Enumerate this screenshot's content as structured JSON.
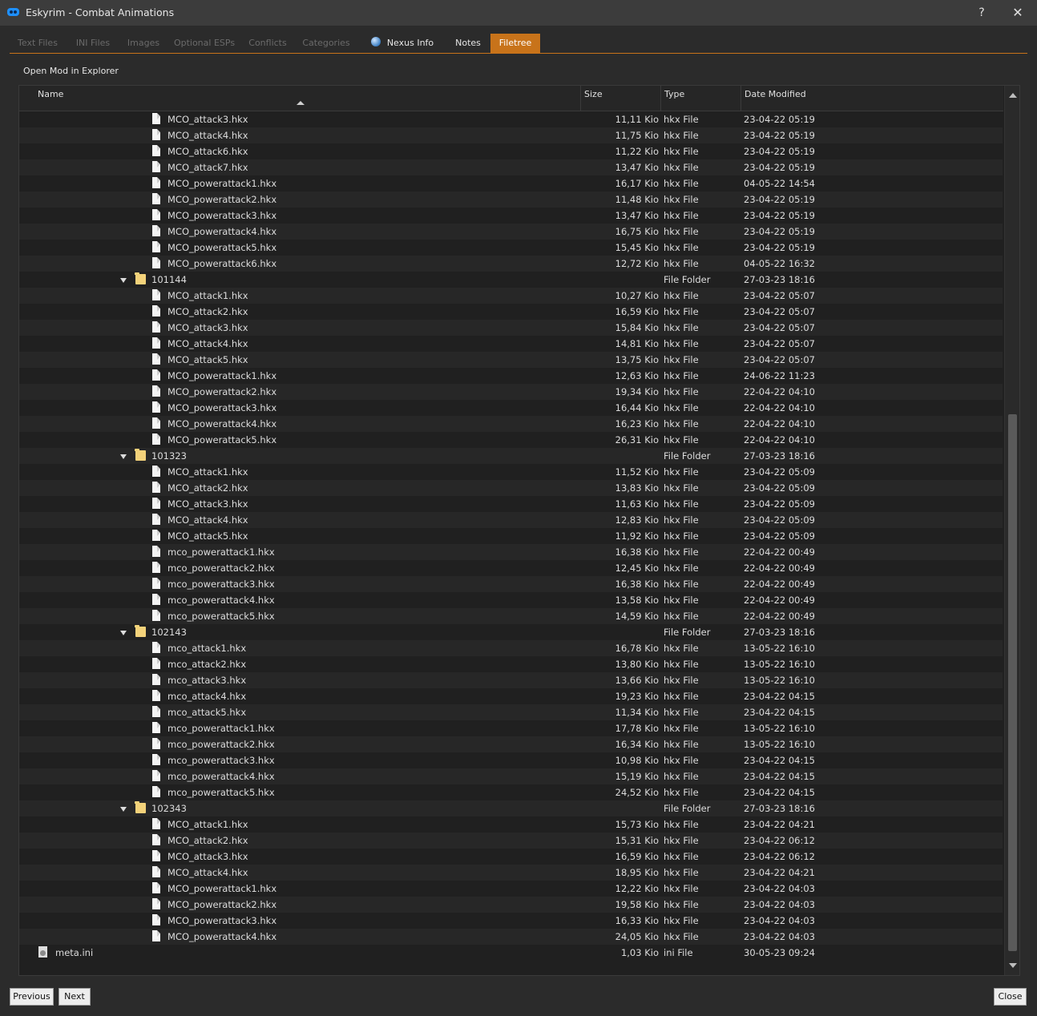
{
  "window": {
    "title": "Eskyrim - Combat Animations",
    "help": "?",
    "close": "✕"
  },
  "tabs": [
    {
      "label": "Text Files"
    },
    {
      "label": "INI Files"
    },
    {
      "label": "Images"
    },
    {
      "label": "Optional ESPs"
    },
    {
      "label": "Conflicts"
    },
    {
      "label": "Categories"
    },
    {
      "label": "Nexus Info",
      "icon": "globe-icon"
    },
    {
      "label": "Notes"
    },
    {
      "label": "Filetree"
    }
  ],
  "toolbar": {
    "open_mod": "Open Mod in Explorer"
  },
  "columns": {
    "name": "Name",
    "size": "Size",
    "type": "Type",
    "date": "Date Modified"
  },
  "rows": [
    {
      "kind": "file",
      "name": "MCO_attack3.hkx",
      "size": "11,11 Kio",
      "type": "hkx File",
      "date": "23-04-22 05:19"
    },
    {
      "kind": "file",
      "name": "MCO_attack4.hkx",
      "size": "11,75 Kio",
      "type": "hkx File",
      "date": "23-04-22 05:19"
    },
    {
      "kind": "file",
      "name": "MCO_attack6.hkx",
      "size": "11,22 Kio",
      "type": "hkx File",
      "date": "23-04-22 05:19"
    },
    {
      "kind": "file",
      "name": "MCO_attack7.hkx",
      "size": "13,47 Kio",
      "type": "hkx File",
      "date": "23-04-22 05:19"
    },
    {
      "kind": "file",
      "name": "MCO_powerattack1.hkx",
      "size": "16,17 Kio",
      "type": "hkx File",
      "date": "04-05-22 14:54"
    },
    {
      "kind": "file",
      "name": "MCO_powerattack2.hkx",
      "size": "11,48 Kio",
      "type": "hkx File",
      "date": "23-04-22 05:19"
    },
    {
      "kind": "file",
      "name": "MCO_powerattack3.hkx",
      "size": "13,47 Kio",
      "type": "hkx File",
      "date": "23-04-22 05:19"
    },
    {
      "kind": "file",
      "name": "MCO_powerattack4.hkx",
      "size": "16,75 Kio",
      "type": "hkx File",
      "date": "23-04-22 05:19"
    },
    {
      "kind": "file",
      "name": "MCO_powerattack5.hkx",
      "size": "15,45 Kio",
      "type": "hkx File",
      "date": "23-04-22 05:19"
    },
    {
      "kind": "file",
      "name": "MCO_powerattack6.hkx",
      "size": "12,72 Kio",
      "type": "hkx File",
      "date": "04-05-22 16:32"
    },
    {
      "kind": "folder",
      "name": "101144",
      "size": "",
      "type": "File Folder",
      "date": "27-03-23 18:16"
    },
    {
      "kind": "file",
      "name": "MCO_attack1.hkx",
      "size": "10,27 Kio",
      "type": "hkx File",
      "date": "23-04-22 05:07"
    },
    {
      "kind": "file",
      "name": "MCO_attack2.hkx",
      "size": "16,59 Kio",
      "type": "hkx File",
      "date": "23-04-22 05:07"
    },
    {
      "kind": "file",
      "name": "MCO_attack3.hkx",
      "size": "15,84 Kio",
      "type": "hkx File",
      "date": "23-04-22 05:07"
    },
    {
      "kind": "file",
      "name": "MCO_attack4.hkx",
      "size": "14,81 Kio",
      "type": "hkx File",
      "date": "23-04-22 05:07"
    },
    {
      "kind": "file",
      "name": "MCO_attack5.hkx",
      "size": "13,75 Kio",
      "type": "hkx File",
      "date": "23-04-22 05:07"
    },
    {
      "kind": "file",
      "name": "MCO_powerattack1.hkx",
      "size": "12,63 Kio",
      "type": "hkx File",
      "date": "24-06-22 11:23"
    },
    {
      "kind": "file",
      "name": "MCO_powerattack2.hkx",
      "size": "19,34 Kio",
      "type": "hkx File",
      "date": "22-04-22 04:10"
    },
    {
      "kind": "file",
      "name": "MCO_powerattack3.hkx",
      "size": "16,44 Kio",
      "type": "hkx File",
      "date": "22-04-22 04:10"
    },
    {
      "kind": "file",
      "name": "MCO_powerattack4.hkx",
      "size": "16,23 Kio",
      "type": "hkx File",
      "date": "22-04-22 04:10"
    },
    {
      "kind": "file",
      "name": "MCO_powerattack5.hkx",
      "size": "26,31 Kio",
      "type": "hkx File",
      "date": "22-04-22 04:10"
    },
    {
      "kind": "folder",
      "name": "101323",
      "size": "",
      "type": "File Folder",
      "date": "27-03-23 18:16"
    },
    {
      "kind": "file",
      "name": "MCO_attack1.hkx",
      "size": "11,52 Kio",
      "type": "hkx File",
      "date": "23-04-22 05:09"
    },
    {
      "kind": "file",
      "name": "MCO_attack2.hkx",
      "size": "13,83 Kio",
      "type": "hkx File",
      "date": "23-04-22 05:09"
    },
    {
      "kind": "file",
      "name": "MCO_attack3.hkx",
      "size": "11,63 Kio",
      "type": "hkx File",
      "date": "23-04-22 05:09"
    },
    {
      "kind": "file",
      "name": "MCO_attack4.hkx",
      "size": "12,83 Kio",
      "type": "hkx File",
      "date": "23-04-22 05:09"
    },
    {
      "kind": "file",
      "name": "MCO_attack5.hkx",
      "size": "11,92 Kio",
      "type": "hkx File",
      "date": "23-04-22 05:09"
    },
    {
      "kind": "file",
      "name": "mco_powerattack1.hkx",
      "size": "16,38 Kio",
      "type": "hkx File",
      "date": "22-04-22 00:49"
    },
    {
      "kind": "file",
      "name": "mco_powerattack2.hkx",
      "size": "12,45 Kio",
      "type": "hkx File",
      "date": "22-04-22 00:49"
    },
    {
      "kind": "file",
      "name": "mco_powerattack3.hkx",
      "size": "16,38 Kio",
      "type": "hkx File",
      "date": "22-04-22 00:49"
    },
    {
      "kind": "file",
      "name": "mco_powerattack4.hkx",
      "size": "13,58 Kio",
      "type": "hkx File",
      "date": "22-04-22 00:49"
    },
    {
      "kind": "file",
      "name": "mco_powerattack5.hkx",
      "size": "14,59 Kio",
      "type": "hkx File",
      "date": "22-04-22 00:49"
    },
    {
      "kind": "folder",
      "name": "102143",
      "size": "",
      "type": "File Folder",
      "date": "27-03-23 18:16"
    },
    {
      "kind": "file",
      "name": "mco_attack1.hkx",
      "size": "16,78 Kio",
      "type": "hkx File",
      "date": "13-05-22 16:10"
    },
    {
      "kind": "file",
      "name": "mco_attack2.hkx",
      "size": "13,80 Kio",
      "type": "hkx File",
      "date": "13-05-22 16:10"
    },
    {
      "kind": "file",
      "name": "mco_attack3.hkx",
      "size": "13,66 Kio",
      "type": "hkx File",
      "date": "13-05-22 16:10"
    },
    {
      "kind": "file",
      "name": "mco_attack4.hkx",
      "size": "19,23 Kio",
      "type": "hkx File",
      "date": "23-04-22 04:15"
    },
    {
      "kind": "file",
      "name": "mco_attack5.hkx",
      "size": "11,34 Kio",
      "type": "hkx File",
      "date": "23-04-22 04:15"
    },
    {
      "kind": "file",
      "name": "mco_powerattack1.hkx",
      "size": "17,78 Kio",
      "type": "hkx File",
      "date": "13-05-22 16:10"
    },
    {
      "kind": "file",
      "name": "mco_powerattack2.hkx",
      "size": "16,34 Kio",
      "type": "hkx File",
      "date": "13-05-22 16:10"
    },
    {
      "kind": "file",
      "name": "mco_powerattack3.hkx",
      "size": "10,98 Kio",
      "type": "hkx File",
      "date": "23-04-22 04:15"
    },
    {
      "kind": "file",
      "name": "mco_powerattack4.hkx",
      "size": "15,19 Kio",
      "type": "hkx File",
      "date": "23-04-22 04:15"
    },
    {
      "kind": "file",
      "name": "mco_powerattack5.hkx",
      "size": "24,52 Kio",
      "type": "hkx File",
      "date": "23-04-22 04:15"
    },
    {
      "kind": "folder",
      "name": "102343",
      "size": "",
      "type": "File Folder",
      "date": "27-03-23 18:16"
    },
    {
      "kind": "file",
      "name": "MCO_attack1.hkx",
      "size": "15,73 Kio",
      "type": "hkx File",
      "date": "23-04-22 04:21"
    },
    {
      "kind": "file",
      "name": "MCO_attack2.hkx",
      "size": "15,31 Kio",
      "type": "hkx File",
      "date": "23-04-22 06:12"
    },
    {
      "kind": "file",
      "name": "MCO_attack3.hkx",
      "size": "16,59 Kio",
      "type": "hkx File",
      "date": "23-04-22 06:12"
    },
    {
      "kind": "file",
      "name": "MCO_attack4.hkx",
      "size": "18,95 Kio",
      "type": "hkx File",
      "date": "23-04-22 04:21"
    },
    {
      "kind": "file",
      "name": "MCO_powerattack1.hkx",
      "size": "12,22 Kio",
      "type": "hkx File",
      "date": "23-04-22 04:03"
    },
    {
      "kind": "file",
      "name": "MCO_powerattack2.hkx",
      "size": "19,58 Kio",
      "type": "hkx File",
      "date": "23-04-22 04:03"
    },
    {
      "kind": "file",
      "name": "MCO_powerattack3.hkx",
      "size": "16,33 Kio",
      "type": "hkx File",
      "date": "23-04-22 04:03"
    },
    {
      "kind": "file",
      "name": "MCO_powerattack4.hkx",
      "size": "24,05 Kio",
      "type": "hkx File",
      "date": "23-04-22 04:03"
    },
    {
      "kind": "root-file",
      "name": "meta.ini",
      "size": "1,03 Kio",
      "type": "ini File",
      "date": "30-05-23 09:24"
    }
  ],
  "buttons": {
    "previous": "Previous",
    "next": "Next",
    "close": "Close"
  },
  "colors": {
    "accent": "#c8731a",
    "background": "#2b2b2b",
    "folder": "#f3d27a"
  }
}
